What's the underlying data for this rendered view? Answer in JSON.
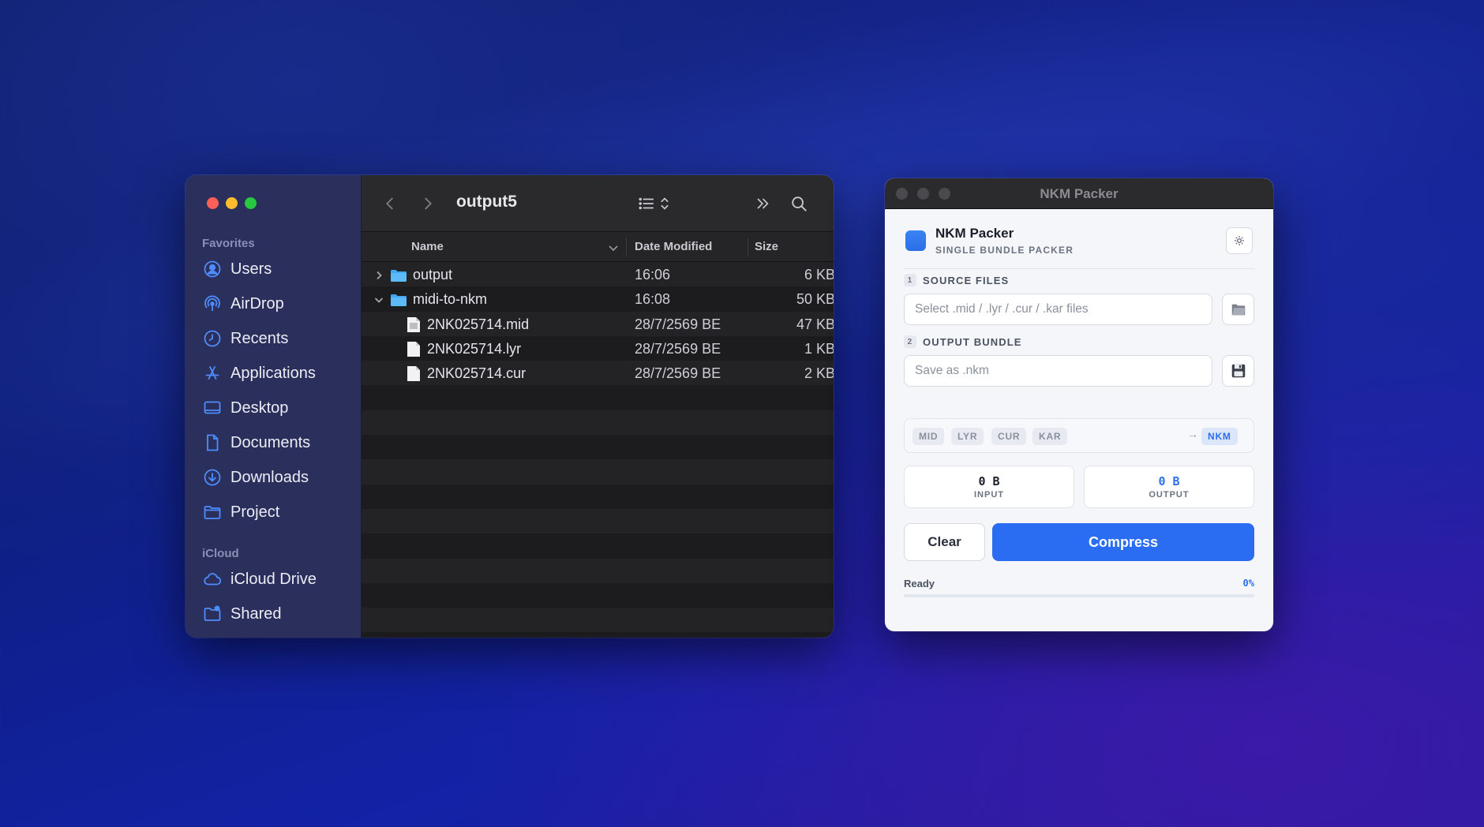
{
  "finder": {
    "title": "output5",
    "sidebar": {
      "favorites_label": "Favorites",
      "favorites": [
        {
          "label": "Users",
          "icon": "person-circle-icon"
        },
        {
          "label": "AirDrop",
          "icon": "airdrop-icon"
        },
        {
          "label": "Recents",
          "icon": "clock-icon"
        },
        {
          "label": "Applications",
          "icon": "applications-icon"
        },
        {
          "label": "Desktop",
          "icon": "desktop-icon"
        },
        {
          "label": "Documents",
          "icon": "document-icon"
        },
        {
          "label": "Downloads",
          "icon": "download-icon"
        },
        {
          "label": "Project",
          "icon": "folder-icon"
        }
      ],
      "icloud_label": "iCloud",
      "icloud": [
        {
          "label": "iCloud Drive",
          "icon": "cloud-icon"
        },
        {
          "label": "Shared",
          "icon": "shared-folder-icon"
        }
      ]
    },
    "columns": {
      "name": "Name",
      "date": "Date Modified",
      "size": "Size"
    },
    "files": [
      {
        "name": "output",
        "date": "16:06",
        "size": "6 KB",
        "kind": "folder",
        "expanded": false
      },
      {
        "name": "midi-to-nkm",
        "date": "16:08",
        "size": "50 KB",
        "kind": "folder",
        "expanded": true
      },
      {
        "name": "2NK025714.mid",
        "date": "28/7/2569 BE",
        "size": "47 KB",
        "kind": "file"
      },
      {
        "name": "2NK025714.lyr",
        "date": "28/7/2569 BE",
        "size": "1 KB",
        "kind": "file"
      },
      {
        "name": "2NK025714.cur",
        "date": "28/7/2569 BE",
        "size": "2 KB",
        "kind": "file"
      }
    ]
  },
  "nkm": {
    "window_title": "NKM Packer",
    "app_name": "NKM Packer",
    "app_subtitle": "SINGLE BUNDLE PACKER",
    "step1": {
      "num": "1",
      "label": "SOURCE FILES",
      "placeholder": "Select .mid / .lyr / .cur / .kar files"
    },
    "step2": {
      "num": "2",
      "label": "OUTPUT BUNDLE",
      "placeholder": "Save as .nkm"
    },
    "formats": [
      "MID",
      "LYR",
      "CUR",
      "KAR"
    ],
    "arrow": "→",
    "target_format": "NKM",
    "input_size": "0 B",
    "input_label": "INPUT",
    "output_size": "0 B",
    "output_label": "OUTPUT",
    "clear_label": "Clear",
    "compress_label": "Compress",
    "status": "Ready",
    "progress_text": "0%",
    "progress": 0,
    "accent": "#2a6cf2"
  }
}
